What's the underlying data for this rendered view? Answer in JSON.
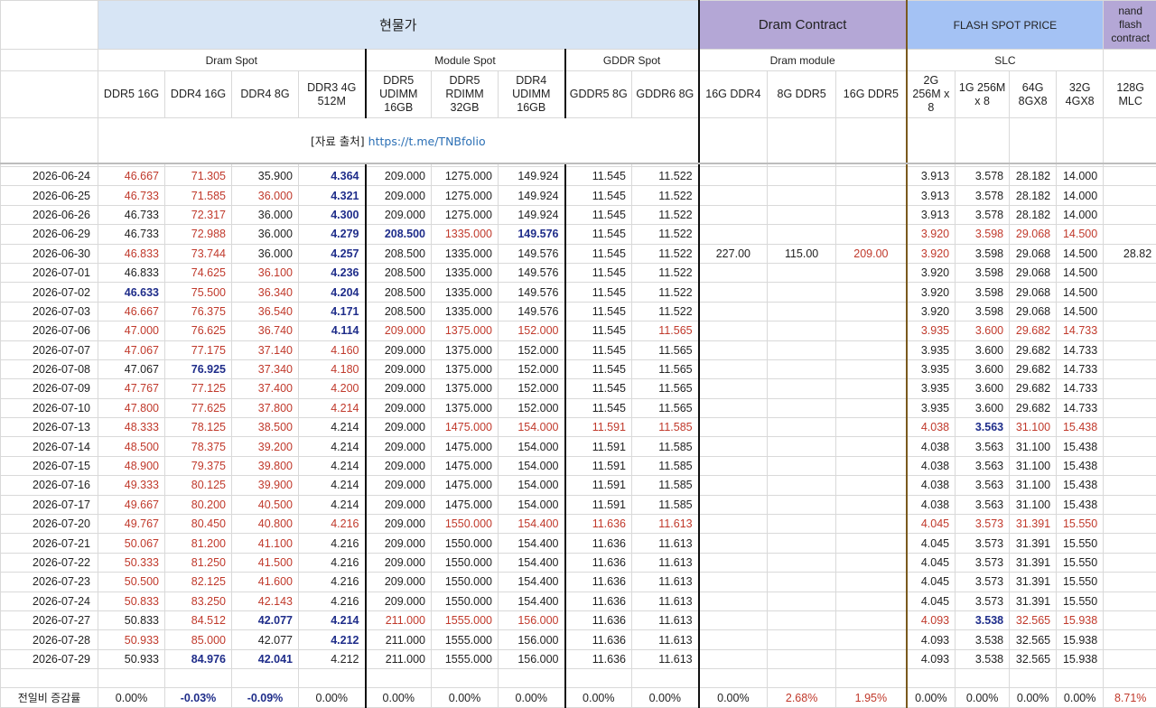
{
  "header": {
    "spot_title": "현물가",
    "dram_contract_title": "Dram Contract",
    "flash_spot_title": "FLASH SPOT PRICE",
    "nand_contract_title": "nand flash contract",
    "dram_spot": "Dram Spot",
    "module_spot": "Module Spot",
    "gddr_spot": "GDDR Spot",
    "dram_module": "Dram module",
    "slc": "SLC"
  },
  "columns": [
    "DDR5 16G",
    "DDR4 16G",
    "DDR4 8G",
    "DDR3 4G 512M",
    "DDR5 UDIMM 16GB",
    "DDR5 RDIMM 32GB",
    "DDR4 UDIMM 16GB",
    "GDDR5 8G",
    "GDDR6 8G",
    "16G DDR4",
    "8G DDR5",
    "16G DDR5",
    "2G 256M x 8",
    "1G 256M x 8",
    "64G 8GX8",
    "32G 4GX8",
    "128G MLC"
  ],
  "source": {
    "label_open": "[자료 출처]",
    "link": "https://t.me/TNBfolio"
  },
  "colors": {
    "up": "#c0392b",
    "down": "#1f2d8a",
    "header_blue": "#d7e5f5",
    "header_purple": "#b4a7d6",
    "header_flash": "#a4c2f4"
  },
  "rows": [
    {
      "date": "2026-06-24",
      "v": [
        "46.667",
        "71.305",
        "35.900",
        "4.364",
        "209.000",
        "1275.000",
        "149.924",
        "11.545",
        "11.522",
        "",
        "",
        "",
        "3.913",
        "3.578",
        "28.182",
        "14.000",
        ""
      ],
      "c": "rr-b-------------"
    },
    {
      "date": "2026-06-25",
      "v": [
        "46.733",
        "71.585",
        "36.000",
        "4.321",
        "209.000",
        "1275.000",
        "149.924",
        "11.545",
        "11.522",
        "",
        "",
        "",
        "3.913",
        "3.578",
        "28.182",
        "14.000",
        ""
      ],
      "c": "rrrb-------------"
    },
    {
      "date": "2026-06-26",
      "v": [
        "46.733",
        "72.317",
        "36.000",
        "4.300",
        "209.000",
        "1275.000",
        "149.924",
        "11.545",
        "11.522",
        "",
        "",
        "",
        "3.913",
        "3.578",
        "28.182",
        "14.000",
        ""
      ],
      "c": "-r-b-------------"
    },
    {
      "date": "2026-06-29",
      "v": [
        "46.733",
        "72.988",
        "36.000",
        "4.279",
        "208.500",
        "1335.000",
        "149.576",
        "11.545",
        "11.522",
        "",
        "",
        "",
        "3.920",
        "3.598",
        "29.068",
        "14.500",
        ""
      ],
      "c": "-r-bbrb-----rrrr-"
    },
    {
      "date": "2026-06-30",
      "v": [
        "46.833",
        "73.744",
        "36.000",
        "4.257",
        "208.500",
        "1335.000",
        "149.576",
        "11.545",
        "11.522",
        "227.00",
        "115.00",
        "209.00",
        "3.920",
        "3.598",
        "29.068",
        "14.500",
        "28.82"
      ],
      "c": "rr-b-------rr----r"
    },
    {
      "date": "2026-07-01",
      "v": [
        "46.833",
        "74.625",
        "36.100",
        "4.236",
        "208.500",
        "1335.000",
        "149.576",
        "11.545",
        "11.522",
        "",
        "",
        "",
        "3.920",
        "3.598",
        "29.068",
        "14.500",
        ""
      ],
      "c": "-rrb-------------"
    },
    {
      "date": "2026-07-02",
      "v": [
        "46.633",
        "75.500",
        "36.340",
        "4.204",
        "208.500",
        "1335.000",
        "149.576",
        "11.545",
        "11.522",
        "",
        "",
        "",
        "3.920",
        "3.598",
        "29.068",
        "14.500",
        ""
      ],
      "c": "brrb-------------"
    },
    {
      "date": "2026-07-03",
      "v": [
        "46.667",
        "76.375",
        "36.540",
        "4.171",
        "208.500",
        "1335.000",
        "149.576",
        "11.545",
        "11.522",
        "",
        "",
        "",
        "3.920",
        "3.598",
        "29.068",
        "14.500",
        ""
      ],
      "c": "rrrb-------------"
    },
    {
      "date": "2026-07-06",
      "v": [
        "47.000",
        "76.625",
        "36.740",
        "4.114",
        "209.000",
        "1375.000",
        "152.000",
        "11.545",
        "11.565",
        "",
        "",
        "",
        "3.935",
        "3.600",
        "29.682",
        "14.733",
        ""
      ],
      "c": "rrrbrrr-r---rrrr-"
    },
    {
      "date": "2026-07-07",
      "v": [
        "47.067",
        "77.175",
        "37.140",
        "4.160",
        "209.000",
        "1375.000",
        "152.000",
        "11.545",
        "11.565",
        "",
        "",
        "",
        "3.935",
        "3.600",
        "29.682",
        "14.733",
        ""
      ],
      "c": "rrrr-------------"
    },
    {
      "date": "2026-07-08",
      "v": [
        "47.067",
        "76.925",
        "37.340",
        "4.180",
        "209.000",
        "1375.000",
        "152.000",
        "11.545",
        "11.565",
        "",
        "",
        "",
        "3.935",
        "3.600",
        "29.682",
        "14.733",
        ""
      ],
      "c": "-brr-------------"
    },
    {
      "date": "2026-07-09",
      "v": [
        "47.767",
        "77.125",
        "37.400",
        "4.200",
        "209.000",
        "1375.000",
        "152.000",
        "11.545",
        "11.565",
        "",
        "",
        "",
        "3.935",
        "3.600",
        "29.682",
        "14.733",
        ""
      ],
      "c": "rrrr-------------"
    },
    {
      "date": "2026-07-10",
      "v": [
        "47.800",
        "77.625",
        "37.800",
        "4.214",
        "209.000",
        "1375.000",
        "152.000",
        "11.545",
        "11.565",
        "",
        "",
        "",
        "3.935",
        "3.600",
        "29.682",
        "14.733",
        ""
      ],
      "c": "rrrr-------------"
    },
    {
      "date": "2026-07-13",
      "v": [
        "48.333",
        "78.125",
        "38.500",
        "4.214",
        "209.000",
        "1475.000",
        "154.000",
        "11.591",
        "11.585",
        "",
        "",
        "",
        "4.038",
        "3.563",
        "31.100",
        "15.438",
        ""
      ],
      "c": "rrr--rrrr---rbrr-"
    },
    {
      "date": "2026-07-14",
      "v": [
        "48.500",
        "78.375",
        "39.200",
        "4.214",
        "209.000",
        "1475.000",
        "154.000",
        "11.591",
        "11.585",
        "",
        "",
        "",
        "4.038",
        "3.563",
        "31.100",
        "15.438",
        ""
      ],
      "c": "rrr--------------"
    },
    {
      "date": "2026-07-15",
      "v": [
        "48.900",
        "79.375",
        "39.800",
        "4.214",
        "209.000",
        "1475.000",
        "154.000",
        "11.591",
        "11.585",
        "",
        "",
        "",
        "4.038",
        "3.563",
        "31.100",
        "15.438",
        ""
      ],
      "c": "rrr--------------"
    },
    {
      "date": "2026-07-16",
      "v": [
        "49.333",
        "80.125",
        "39.900",
        "4.214",
        "209.000",
        "1475.000",
        "154.000",
        "11.591",
        "11.585",
        "",
        "",
        "",
        "4.038",
        "3.563",
        "31.100",
        "15.438",
        ""
      ],
      "c": "rrr--------------"
    },
    {
      "date": "2026-07-17",
      "v": [
        "49.667",
        "80.200",
        "40.500",
        "4.214",
        "209.000",
        "1475.000",
        "154.000",
        "11.591",
        "11.585",
        "",
        "",
        "",
        "4.038",
        "3.563",
        "31.100",
        "15.438",
        ""
      ],
      "c": "rrr--------------"
    },
    {
      "date": "2026-07-20",
      "v": [
        "49.767",
        "80.450",
        "40.800",
        "4.216",
        "209.000",
        "1550.000",
        "154.400",
        "11.636",
        "11.613",
        "",
        "",
        "",
        "4.045",
        "3.573",
        "31.391",
        "15.550",
        ""
      ],
      "c": "rrrr-rrrr---rrrr-"
    },
    {
      "date": "2026-07-21",
      "v": [
        "50.067",
        "81.200",
        "41.100",
        "4.216",
        "209.000",
        "1550.000",
        "154.400",
        "11.636",
        "11.613",
        "",
        "",
        "",
        "4.045",
        "3.573",
        "31.391",
        "15.550",
        ""
      ],
      "c": "rrr--------------"
    },
    {
      "date": "2026-07-22",
      "v": [
        "50.333",
        "81.250",
        "41.500",
        "4.216",
        "209.000",
        "1550.000",
        "154.400",
        "11.636",
        "11.613",
        "",
        "",
        "",
        "4.045",
        "3.573",
        "31.391",
        "15.550",
        ""
      ],
      "c": "rrr--------------"
    },
    {
      "date": "2026-07-23",
      "v": [
        "50.500",
        "82.125",
        "41.600",
        "4.216",
        "209.000",
        "1550.000",
        "154.400",
        "11.636",
        "11.613",
        "",
        "",
        "",
        "4.045",
        "3.573",
        "31.391",
        "15.550",
        ""
      ],
      "c": "rrr--------------"
    },
    {
      "date": "2026-07-24",
      "v": [
        "50.833",
        "83.250",
        "42.143",
        "4.216",
        "209.000",
        "1550.000",
        "154.400",
        "11.636",
        "11.613",
        "",
        "",
        "",
        "4.045",
        "3.573",
        "31.391",
        "15.550",
        ""
      ],
      "c": "rrr--------------"
    },
    {
      "date": "2026-07-27",
      "v": [
        "50.833",
        "84.512",
        "42.077",
        "4.214",
        "211.000",
        "1555.000",
        "156.000",
        "11.636",
        "11.613",
        "",
        "",
        "",
        "4.093",
        "3.538",
        "32.565",
        "15.938",
        ""
      ],
      "c": "-rbbrrr-----rbrr-"
    },
    {
      "date": "2026-07-28",
      "v": [
        "50.933",
        "85.000",
        "42.077",
        "4.212",
        "211.000",
        "1555.000",
        "156.000",
        "11.636",
        "11.613",
        "",
        "",
        "",
        "4.093",
        "3.538",
        "32.565",
        "15.938",
        ""
      ],
      "c": "rr-b-------------"
    },
    {
      "date": "2026-07-29",
      "v": [
        "50.933",
        "84.976",
        "42.041",
        "4.212",
        "211.000",
        "1555.000",
        "156.000",
        "11.636",
        "11.613",
        "",
        "",
        "",
        "4.093",
        "3.538",
        "32.565",
        "15.938",
        ""
      ],
      "c": "-bb--------------"
    }
  ],
  "footer": {
    "label": "전일비 증감률",
    "v": [
      "0.00%",
      "-0.03%",
      "-0.09%",
      "0.00%",
      "0.00%",
      "0.00%",
      "0.00%",
      "0.00%",
      "0.00%",
      "0.00%",
      "2.68%",
      "1.95%",
      "0.00%",
      "0.00%",
      "0.00%",
      "0.00%",
      "8.71%"
    ],
    "c": "-bb-------rr----r"
  }
}
